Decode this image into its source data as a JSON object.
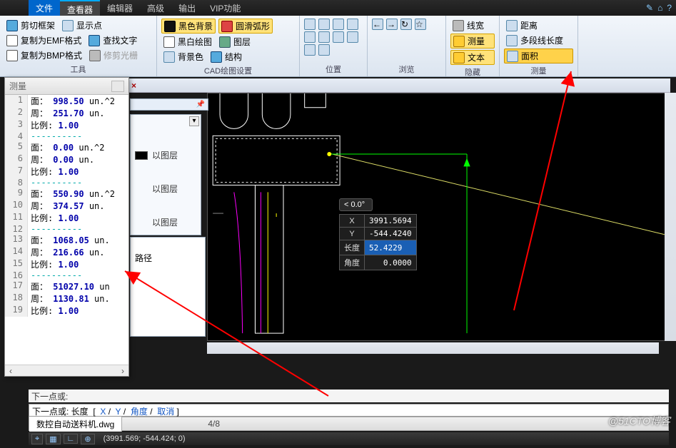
{
  "menu": {
    "file": "文件",
    "tabs": [
      "查看器",
      "编辑器",
      "高级",
      "输出",
      "VIP功能"
    ],
    "active": 0
  },
  "ribbon": {
    "groups": [
      {
        "label": "工具",
        "items": [
          "剪切框架",
          "复制为EMF格式",
          "复制为BMP格式"
        ],
        "col2": [
          "显示点",
          "查找文字",
          "修剪光栅"
        ]
      },
      {
        "label": "CAD绘图设置",
        "row1": [
          "黑色背景",
          "圆滑弧形"
        ],
        "items": [
          "黑白绘图",
          "背景色"
        ],
        "col2": [
          "图层",
          "结构"
        ]
      },
      {
        "label": "位置"
      },
      {
        "label": "浏览"
      },
      {
        "label": "隐藏",
        "items": [
          "线宽",
          "测量",
          "文本"
        ]
      },
      {
        "label": "测量",
        "items": [
          "距离",
          "多段线长度",
          "面积"
        ]
      }
    ]
  },
  "float_panel": {
    "title": "测量",
    "lines": [
      {
        "n": 1,
        "t": "面：",
        "v": "998.50",
        "u": " un.^2"
      },
      {
        "n": 2,
        "t": "周：",
        "v": "251.70",
        "u": " un."
      },
      {
        "n": 3,
        "t": "比例:",
        "v": "1.00",
        "u": ""
      },
      {
        "n": 4,
        "t": "sep"
      },
      {
        "n": 5,
        "t": "面：",
        "v": "0.00",
        "u": " un.^2"
      },
      {
        "n": 6,
        "t": "周：",
        "v": "0.00",
        "u": " un."
      },
      {
        "n": 7,
        "t": "比例:",
        "v": "1.00",
        "u": ""
      },
      {
        "n": 8,
        "t": "sep"
      },
      {
        "n": 9,
        "t": "面：",
        "v": "550.90",
        "u": " un.^2"
      },
      {
        "n": 10,
        "t": "周：",
        "v": "374.57",
        "u": " un."
      },
      {
        "n": 11,
        "t": "比例:",
        "v": "1.00",
        "u": ""
      },
      {
        "n": 12,
        "t": "sep"
      },
      {
        "n": 13,
        "t": "面：",
        "v": "1068.05",
        "u": " un."
      },
      {
        "n": 14,
        "t": "周：",
        "v": "216.66",
        "u": " un."
      },
      {
        "n": 15,
        "t": "比例:",
        "v": "1.00",
        "u": ""
      },
      {
        "n": 16,
        "t": "sep"
      },
      {
        "n": 17,
        "t": "面：",
        "v": "51027.10",
        "u": " un"
      },
      {
        "n": 18,
        "t": "周：",
        "v": "1130.81",
        "u": " un."
      },
      {
        "n": 19,
        "t": "比例:",
        "v": "1.00",
        "u": ""
      }
    ]
  },
  "side": {
    "layer_rows": [
      "以图层",
      "以图层",
      "以图层"
    ],
    "tree_label": "路径"
  },
  "coord_popup": {
    "angle_lock": "< 0.0°",
    "rows": [
      {
        "label": "X",
        "value": "3991.5694"
      },
      {
        "label": "Y",
        "value": "-544.4240"
      },
      {
        "label": "长度",
        "value": "52.4229",
        "selected": true
      },
      {
        "label": "角度",
        "value": "0.0000"
      }
    ]
  },
  "cmd1": "下一点或:",
  "cmd2": {
    "prefix": "下一点或: 长度",
    "links": [
      "X",
      "Y",
      "角度",
      "取消"
    ]
  },
  "tabbar": {
    "doc": "数控自动送料机.dwg",
    "page": "4/8"
  },
  "status": {
    "coords": "(3991.569; -544.424; 0)"
  },
  "watermark": "@51CTO博客"
}
